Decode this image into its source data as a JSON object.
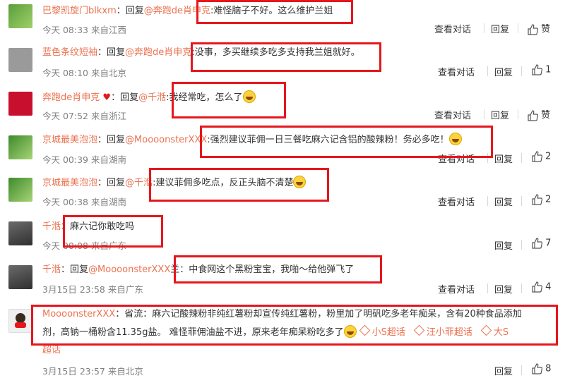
{
  "labels": {
    "reply_prefix": "回复",
    "view_conversation": "查看对话",
    "reply": "回复",
    "like": "赞"
  },
  "comments": [
    {
      "user": "巴黎凯旋门blkxm",
      "colon": "：",
      "reply_word": "回复",
      "mention": "@奔跑de肖申克",
      "text": ":难怪脑子不好。这么维护兰姐",
      "time": "今天 08:33 来自江西",
      "like_text": "赞"
    },
    {
      "user": "蓝色条纹短袖",
      "colon": "：",
      "reply_word": "回复",
      "mention": "@奔跑de肖申克",
      "text": ":没事，多买继续多吃多支持我兰姐就好。",
      "time": "今天 08:10 来自北京",
      "like_text": "1"
    },
    {
      "user": "奔跑de肖申克",
      "colon": "：",
      "reply_word": "回复",
      "mention": "@千湉",
      "text": ":我经常吃，怎么了",
      "time": "今天 07:52 来自浙江",
      "like_text": "赞"
    },
    {
      "user": "京城最美泡泡",
      "colon": "：",
      "reply_word": "回复",
      "mention": "@MoooonsterXXX",
      "text": ":强烈建议菲佣一日三餐吃麻六记含铝的酸辣粉！务必多吃！",
      "time": "今天 00:39 来自湖南",
      "like_text": "2"
    },
    {
      "user": "京城最美泡泡",
      "colon": "：",
      "reply_word": "回复",
      "mention": "@千湉",
      "text": ":建议菲佣多吃点，反正头脑不清楚",
      "time": "今天 00:38 来自湖南",
      "like_text": "2"
    },
    {
      "user": "千湉",
      "colon": "：",
      "text": "麻六记你敢吃吗",
      "time": "今天 00:08 来自广东",
      "like_text": "7"
    },
    {
      "user": "千湉",
      "colon": "：",
      "reply_word": "回复",
      "mention": "@MoooonsterXXX",
      "text": "兰：中食网这个黑粉宝宝，我啪～给他弹飞了",
      "time": "3月15日 23:58 来自广东",
      "like_text": "4"
    },
    {
      "user": "MoooonsterXXX",
      "colon": "：",
      "text_line1": "省流：麻六记酸辣粉非纯红薯粉却宣传纯红薯粉，粉里加了明矾吃多老年痴呆，含有20种食品添加",
      "text_line2": "剂，高钠一桶粉含11.35g盐。 难怪菲佣油盐不进，原来老年痴呆粉吃多了",
      "badges": [
        "小S超话",
        "汪小菲超话",
        "大S"
      ],
      "badge_tail": "超话",
      "time": "3月15日 23:57 来自北京",
      "like_text": "8"
    }
  ],
  "colors": {
    "username": "#eb7350",
    "highlight_box": "#e6161d"
  }
}
